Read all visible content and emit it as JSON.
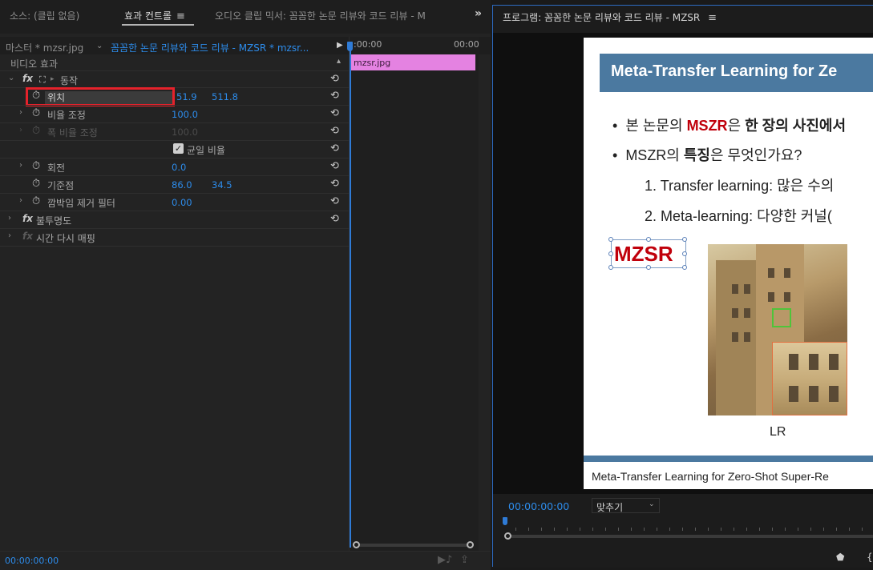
{
  "left_panel": {
    "tabs": {
      "source": "소스: (클립 없음)",
      "effect_controls": "효과 컨트롤",
      "audio_mixer": "오디오 클립 믹서: 꼼꼼한 논문 리뷰와 코드 리뷰 - M",
      "overflow": "»",
      "menu": "≡"
    },
    "clip_header": {
      "master": "마스터 * mzsr.jpg",
      "sequence": "꼼꼼한 논문 리뷰와 코드 리뷰 - MZSR * mzsr...",
      "arrow": "▶"
    },
    "effects": {
      "video_effects_header": "비디오 효과",
      "motion": "동작",
      "position_label": "위치",
      "position_x": "51.9",
      "position_y": "511.8",
      "scale_label": "비율 조정",
      "scale_value": "100.0",
      "scale_width_label": "폭 비율 조정",
      "scale_width_value": "100.0",
      "uniform_scale_label": "균일 비율",
      "rotation_label": "회전",
      "rotation_value": "0.0",
      "anchor_label": "기준점",
      "anchor_x": "86.0",
      "anchor_y": "34.5",
      "flicker_label": "깜박임 제거 필터",
      "flicker_value": "0.00",
      "opacity_label": "불투명도",
      "time_remap_label": "시간 다시 매핑"
    },
    "timeline": {
      "ruler_start": ":00:00",
      "ruler_end": "00:00",
      "clip_name": "mzsr.jpg"
    },
    "footer_time": "00:00:00:00"
  },
  "right_panel": {
    "title": "프로그램: 꼼꼼한 논문 리뷰와 코드 리뷰 - MZSR",
    "menu": "≡",
    "slide": {
      "title": "Meta-Transfer Learning for Ze",
      "bullet1_pre": "본 논문의 ",
      "bullet1_red": "MSZR",
      "bullet1_mid": "은 ",
      "bullet1_bold": "한 장의 사진에서",
      "bullet2_pre": "MSZR의 ",
      "bullet2_bold": "특징",
      "bullet2_post": "은 무엇인가요?",
      "item1": "1.  Transfer learning: 많은 수의",
      "item2": "2.  Meta-learning: 다양한 커널(",
      "logo": "MZSR",
      "image_label": "LR",
      "footer": "Meta-Transfer Learning for Zero-Shot Super-Re"
    },
    "time": "00:00:00:00",
    "fit_select": "맞추기"
  }
}
